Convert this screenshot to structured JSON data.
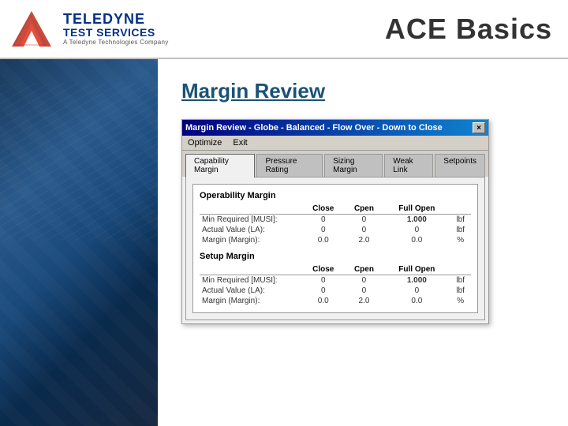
{
  "header": {
    "logo": {
      "company_line1": "TELEDYNE",
      "company_line2": "TEST SERVICES",
      "tagline": "A Teledyne Technologies Company"
    },
    "title": "ACE Basics"
  },
  "main": {
    "section_title": "Margin Review",
    "dialog": {
      "title": "Margin Review - Globe - Balanced - Flow Over - Down to Close",
      "close_label": "×",
      "menu": {
        "items": [
          "Optimize",
          "Exit"
        ]
      },
      "tabs": [
        {
          "label": "Capability Margin",
          "active": true
        },
        {
          "label": "Pressure Rating"
        },
        {
          "label": "Sizing Margin"
        },
        {
          "label": "Weak Link"
        },
        {
          "label": "Setpoints"
        }
      ],
      "panel": {
        "sections": [
          {
            "title": "Operability Margin",
            "columns": [
              "",
              "Close",
              "Cpen",
              "Full Open",
              ""
            ],
            "rows": [
              {
                "label": "Min Required [MUSI]:",
                "close": "0",
                "cpen": "0",
                "full_open": "1.000",
                "unit": "lbf"
              },
              {
                "label": "Actual Value (LA):",
                "close": "0",
                "cpen": "0",
                "full_open": "0",
                "unit": "lbf"
              },
              {
                "label": "Margin (Margin):",
                "close": "0.0",
                "cpen": "2.0",
                "full_open": "0.0",
                "unit": "%"
              }
            ]
          },
          {
            "title": "Setup Margin",
            "columns": [
              "",
              "Close",
              "Cpen",
              "Full Open",
              ""
            ],
            "rows": [
              {
                "label": "Min Required [MUSI]:",
                "close": "0",
                "cpen": "0",
                "full_open": "1.000",
                "unit": "lbf"
              },
              {
                "label": "Actual Value (LA):",
                "close": "0",
                "cpen": "0",
                "full_open": "0",
                "unit": "lbf"
              },
              {
                "label": "Margin (Margin):",
                "close": "0.0",
                "cpen": "2.0",
                "full_open": "0.0",
                "unit": "%"
              }
            ]
          }
        ]
      }
    }
  }
}
